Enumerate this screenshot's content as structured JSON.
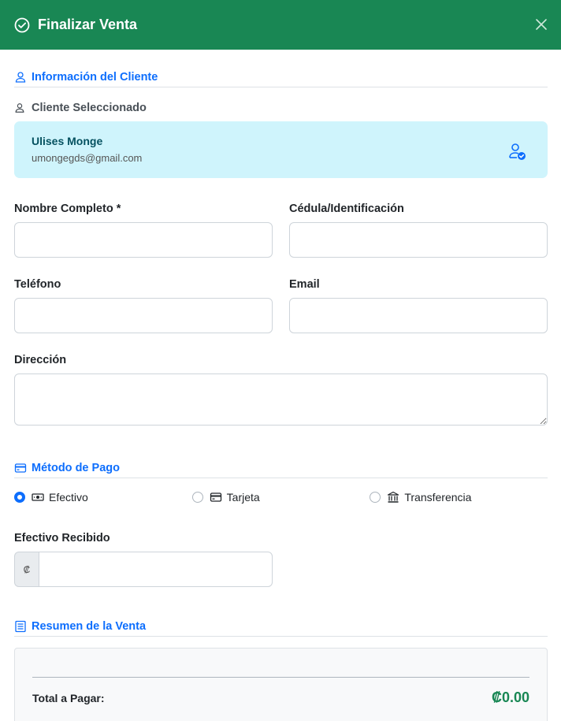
{
  "modal": {
    "title": "Finalizar Venta"
  },
  "client_section": {
    "title": "Información del Cliente",
    "selected_label": "Cliente Seleccionado",
    "selected_client": {
      "name": "Ulises Monge",
      "email": "umongegds@gmail.com"
    }
  },
  "form": {
    "full_name": {
      "label": "Nombre Completo *",
      "value": ""
    },
    "id_number": {
      "label": "Cédula/Identificación",
      "value": ""
    },
    "phone": {
      "label": "Teléfono",
      "value": ""
    },
    "email": {
      "label": "Email",
      "value": ""
    },
    "address": {
      "label": "Dirección",
      "value": ""
    }
  },
  "payment_section": {
    "title": "Método de Pago",
    "options": [
      {
        "label": "Efectivo",
        "selected": true,
        "icon": "cash-icon"
      },
      {
        "label": "Tarjeta",
        "selected": false,
        "icon": "credit-card-icon"
      },
      {
        "label": "Transferencia",
        "selected": false,
        "icon": "bank-icon"
      }
    ],
    "cash_received": {
      "label": "Efectivo Recibido",
      "currency_symbol": "₡",
      "value": ""
    }
  },
  "summary_section": {
    "title": "Resumen de la Venta",
    "total_label": "Total a Pagar:",
    "total_value": "₡0.00"
  },
  "colors": {
    "header": "#198754",
    "accent": "#0d6efd",
    "client_card": "#cff4fc"
  }
}
